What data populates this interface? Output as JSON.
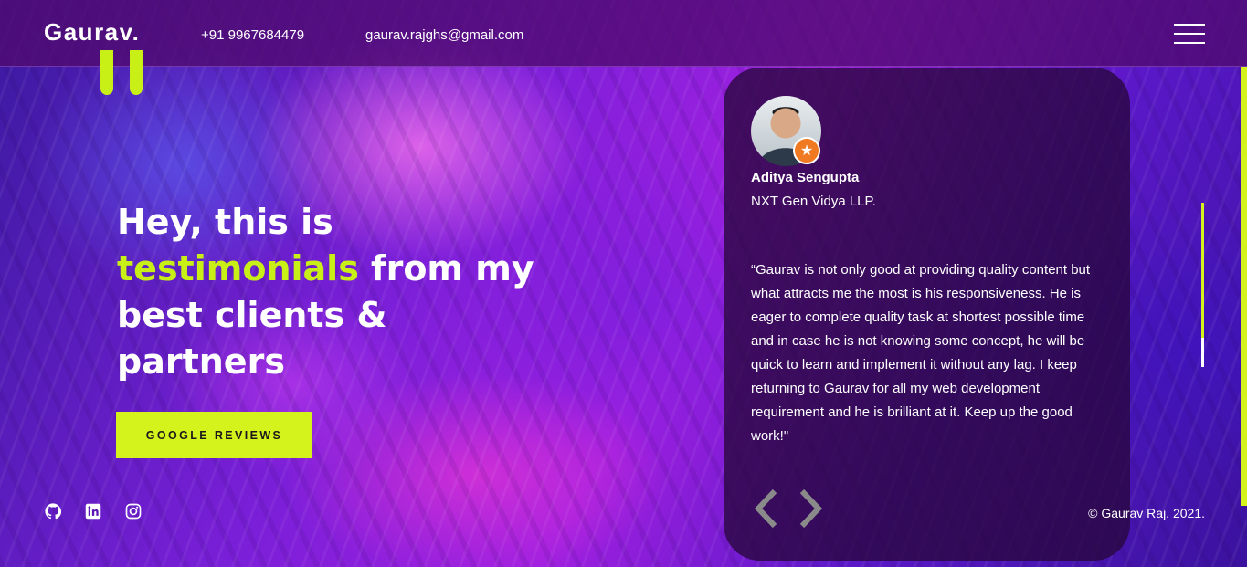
{
  "header": {
    "logo": "Gaurav.",
    "phone": "+91 9967684479",
    "email": "gaurav.rajghs@gmail.com",
    "menu_icon": "hamburger-menu-icon"
  },
  "hero": {
    "title_part1": "Hey, this is",
    "title_accent": "testimonials",
    "title_part2": "from my best clients & partners",
    "button_label": "GOOGLE REVIEWS"
  },
  "socials": [
    "github-icon",
    "linkedin-icon",
    "instagram-icon"
  ],
  "testimonial": {
    "name": "Aditya Sengupta",
    "company": "NXT Gen Vidya LLP.",
    "quote": "“Gaurav is not only good at providing quality content but what attracts me the most is his responsiveness. He is eager to complete quality task at shortest possible time and in case he is not knowing some concept, he will be quick to learn and implement it without any lag. I keep returning to Gaurav for all my web development requirement and he is brilliant at it. Keep up the good work!\"",
    "prev_icon": "chevron-left-icon",
    "next_icon": "chevron-right-icon"
  },
  "footer": {
    "copyright": "© Gaurav Raj. 2021."
  },
  "colors": {
    "accent": "#d4f31c",
    "accent_text": "#c8f016",
    "card_bg": "#28063c",
    "badge": "#f07a22"
  },
  "scroll_progress": 0.82
}
